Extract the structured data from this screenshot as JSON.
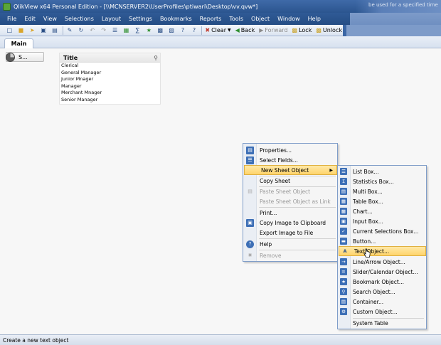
{
  "window": {
    "title": "QlikView x64 Personal Edition - [\\\\MCNSERVER2\\UserProfiles\\ptiwari\\Desktop\\vv.qvw*]",
    "background_text": "be used for a specified time"
  },
  "menubar": {
    "items": [
      "File",
      "Edit",
      "View",
      "Selections",
      "Layout",
      "Settings",
      "Bookmarks",
      "Reports",
      "Tools",
      "Object",
      "Window",
      "Help"
    ]
  },
  "toolbar": {
    "clear_label": "Clear",
    "back_label": "Back",
    "forward_label": "Forward",
    "lock_label": "Lock",
    "unlock_label": "Unlock"
  },
  "tabs": {
    "main_label": "Main"
  },
  "mini_object": {
    "label": "S..."
  },
  "listbox": {
    "title": "Title",
    "items": [
      "Clerical",
      "General Manager",
      "Junior Mnager",
      "Manager",
      "Merchant Mnager",
      "Senior Manager"
    ]
  },
  "context_menu": {
    "properties": "Properties...",
    "select_fields": "Select Fields...",
    "new_sheet_object": "New Sheet Object",
    "copy_sheet": "Copy Sheet",
    "paste_sheet_object": "Paste Sheet Object",
    "paste_sheet_object_link": "Paste Sheet Object as Link",
    "print": "Print...",
    "copy_image": "Copy Image to Clipboard",
    "export_image": "Export Image to File",
    "help": "Help",
    "remove": "Remove"
  },
  "submenu": {
    "list_box": "List Box...",
    "statistics_box": "Statistics Box...",
    "multi_box": "Multi Box...",
    "table_box": "Table Box...",
    "chart": "Chart...",
    "input_box": "Input Box...",
    "current_selections_box": "Current Selections Box...",
    "button": "Button...",
    "text_object": "Text Object...",
    "line_arrow_object": "Line/Arrow Object...",
    "slider_calendar_object": "Slider/Calendar Object...",
    "bookmark_object": "Bookmark Object...",
    "search_object": "Search Object...",
    "container": "Container...",
    "custom_object": "Custom Object...",
    "system_table": "System Table"
  },
  "statusbar": {
    "text": "Create a new text object"
  },
  "colors": {
    "titlebar": "#2b558f",
    "highlight": "#ffd46b",
    "menu_border": "#7f9dc9"
  }
}
